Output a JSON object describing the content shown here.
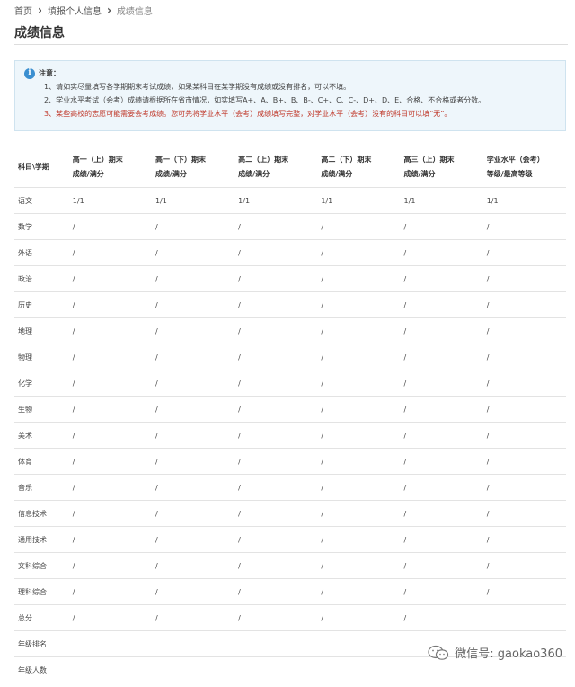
{
  "breadcrumb": {
    "home": "首页",
    "step": "填报个人信息",
    "current": "成绩信息"
  },
  "page_title": "成绩信息",
  "notice": {
    "heading": "注意：",
    "items": [
      "1、请如实尽量填写各学期期末考试成绩，如果某科目在某学期没有成绩或没有排名，可以不填。",
      "2、学业水平考试（会考）成绩请根据所在省市情况，如实填写A+、A、B+、B、B-、C+、C、C-、D+、D、E、合格、不合格或者分数。",
      "3、某些高校的志愿可能需要会考成绩。您可先将学业水平（会考）成绩填写完整，对学业水平（会考）没有的科目可以填“无”。"
    ]
  },
  "table": {
    "corner_header": "科目\\学期",
    "columns": [
      {
        "line1": "高一（上）期末",
        "line2": "成绩/满分"
      },
      {
        "line1": "高一（下）期末",
        "line2": "成绩/满分"
      },
      {
        "line1": "高二（上）期末",
        "line2": "成绩/满分"
      },
      {
        "line1": "高二（下）期末",
        "line2": "成绩/满分"
      },
      {
        "line1": "高三（上）期末",
        "line2": "成绩/满分"
      },
      {
        "line1": "学业水平（会考）",
        "line2": "等级/最高等级"
      }
    ],
    "rows": [
      {
        "subject": "语文",
        "cells": [
          "1/1",
          "1/1",
          "1/1",
          "1/1",
          "1/1",
          "1/1"
        ]
      },
      {
        "subject": "数学",
        "cells": [
          "/",
          "/",
          "/",
          "/",
          "/",
          "/"
        ]
      },
      {
        "subject": "外语",
        "cells": [
          "/",
          "/",
          "/",
          "/",
          "/",
          "/"
        ]
      },
      {
        "subject": "政治",
        "cells": [
          "/",
          "/",
          "/",
          "/",
          "/",
          "/"
        ]
      },
      {
        "subject": "历史",
        "cells": [
          "/",
          "/",
          "/",
          "/",
          "/",
          "/"
        ]
      },
      {
        "subject": "地理",
        "cells": [
          "/",
          "/",
          "/",
          "/",
          "/",
          "/"
        ]
      },
      {
        "subject": "物理",
        "cells": [
          "/",
          "/",
          "/",
          "/",
          "/",
          "/"
        ]
      },
      {
        "subject": "化学",
        "cells": [
          "/",
          "/",
          "/",
          "/",
          "/",
          "/"
        ]
      },
      {
        "subject": "生物",
        "cells": [
          "/",
          "/",
          "/",
          "/",
          "/",
          "/"
        ]
      },
      {
        "subject": "美术",
        "cells": [
          "/",
          "/",
          "/",
          "/",
          "/",
          "/"
        ]
      },
      {
        "subject": "体育",
        "cells": [
          "/",
          "/",
          "/",
          "/",
          "/",
          "/"
        ]
      },
      {
        "subject": "音乐",
        "cells": [
          "/",
          "/",
          "/",
          "/",
          "/",
          "/"
        ]
      },
      {
        "subject": "信息技术",
        "cells": [
          "/",
          "/",
          "/",
          "/",
          "/",
          "/"
        ]
      },
      {
        "subject": "通用技术",
        "cells": [
          "/",
          "/",
          "/",
          "/",
          "/",
          "/"
        ]
      },
      {
        "subject": "文科综合",
        "cells": [
          "/",
          "/",
          "/",
          "/",
          "/",
          "/"
        ]
      },
      {
        "subject": "理科综合",
        "cells": [
          "/",
          "/",
          "/",
          "/",
          "/",
          "/"
        ]
      },
      {
        "subject": "总分",
        "cells": [
          "/",
          "/",
          "/",
          "/",
          "/",
          ""
        ]
      },
      {
        "subject": "年级排名",
        "cells": [
          "",
          "",
          "",
          "",
          "",
          ""
        ]
      },
      {
        "subject": "年级人数",
        "cells": [
          "",
          "",
          "",
          "",
          "",
          ""
        ]
      }
    ]
  },
  "watermark": {
    "text": "微信号: gaokao360",
    "icon": "wechat-icon"
  },
  "colors": {
    "accent": "#3b8fd0",
    "warning": "#c0392b",
    "notice_bg": "#eef6fb"
  }
}
